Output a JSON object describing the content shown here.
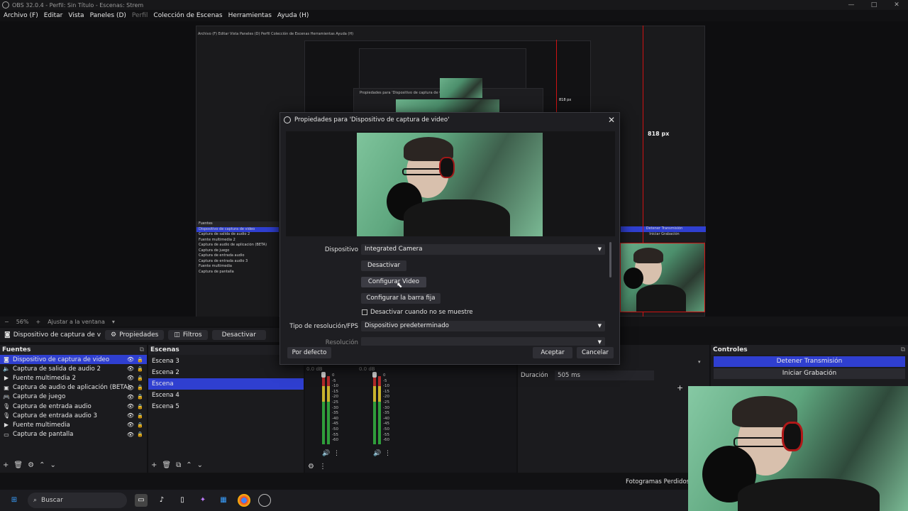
{
  "titlebar": {
    "title": "OBS 32.0.4 - Perfil: Sin Título - Escenas: Strem",
    "min": "—",
    "max": "□",
    "close": "✕"
  },
  "menu": {
    "items": [
      "Archivo (F)",
      "Editar",
      "Vista",
      "Paneles (D)",
      "Perfil",
      "Colección de Escenas",
      "Herramientas",
      "Ayuda (H)"
    ]
  },
  "preview": {
    "measure_label": "818 px",
    "nested_window_title": "Propiedades para 'Dispositivo de captura de video'"
  },
  "zoombar": {
    "zoom": "56%",
    "fit": "Ajustar a la ventana"
  },
  "source_toolbar": {
    "source_name": "Dispositivo de captura de v",
    "properties": "Propiedades",
    "filters": "Filtros",
    "deactivate": "Desactivar"
  },
  "sources": {
    "title": "Fuentes",
    "items": [
      {
        "label": "Dispositivo de captura de video",
        "icon": "camera-icon"
      },
      {
        "label": "Captura de salida de audio 2",
        "icon": "speaker-icon"
      },
      {
        "label": "Fuente multimedia 2",
        "icon": "play-icon"
      },
      {
        "label": "Captura de audio de aplicación (BETA)",
        "icon": "app-audio-icon"
      },
      {
        "label": "Captura de juego",
        "icon": "gamepad-icon"
      },
      {
        "label": "Captura de entrada audio",
        "icon": "mic-icon"
      },
      {
        "label": "Captura de entrada audio 3",
        "icon": "mic-icon"
      },
      {
        "label": "Fuente multimedia",
        "icon": "play-icon"
      },
      {
        "label": "Captura de pantalla",
        "icon": "monitor-icon"
      }
    ]
  },
  "scenes": {
    "title": "Escenas",
    "items": [
      "Escena 3",
      "Escena 2",
      "Escena",
      "Escena 4",
      "Escena 5"
    ]
  },
  "mixer": {
    "db1": "0.0 dB",
    "db2": "0.0 dB",
    "ticks": [
      "0",
      "-5",
      "-10",
      "-15",
      "-20",
      "-25",
      "-30",
      "-35",
      "-40",
      "-45",
      "-50",
      "-55",
      "-60"
    ]
  },
  "transitions": {
    "duration_label": "Duración",
    "duration_value": "505 ms"
  },
  "controls": {
    "title": "Controles",
    "stop_stream": "Detener Transmisión",
    "start_recording": "Iniciar Grabación"
  },
  "dialog": {
    "title": "Propiedades para 'Dispositivo de captura de video'",
    "device_label": "Dispositivo",
    "device_value": "Integrated Camera",
    "btn_deactivate": "Desactivar",
    "btn_config_video": "Configurar Video",
    "btn_config_crossbar": "Configurar la barra fija",
    "chk_hide": "Desactivar cuando no se muestre",
    "res_type_label": "Tipo de resolución/FPS",
    "res_type_value": "Dispositivo predeterminado",
    "resolution_label": "Resolución",
    "btn_defaults": "Por defecto",
    "btn_ok": "Aceptar",
    "btn_cancel": "Cancelar"
  },
  "statusbar": {
    "dropped_frames": "Fotogramas Perdidos"
  },
  "taskbar": {
    "search_placeholder": "Buscar"
  },
  "colors": {
    "accent": "#2f3fd0",
    "guide_red": "#d01212"
  }
}
